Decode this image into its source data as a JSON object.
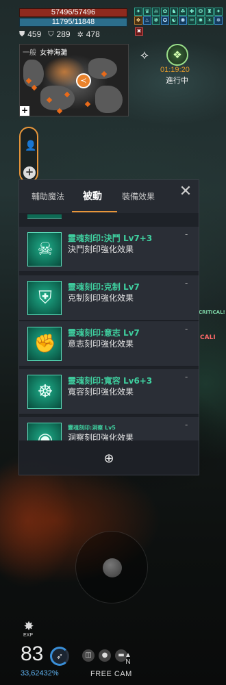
{
  "player": {
    "hp": "57496/57496",
    "mp": "11795/11848",
    "stats": [
      {
        "icon": "shield-icon",
        "glyph": "⛊",
        "value": "459"
      },
      {
        "icon": "defense-icon",
        "glyph": "⛉",
        "value": "289"
      },
      {
        "icon": "star-icon",
        "glyph": "✲",
        "value": "478"
      }
    ]
  },
  "buffs": {
    "row1": [
      "✦",
      "♛",
      "☠",
      "✿",
      "♞",
      "☘",
      "✚",
      "❂",
      "♜",
      "✦",
      "✧",
      "☗"
    ],
    "row2": [
      "❖",
      "♨",
      "❃",
      "✪",
      "☯",
      "✺",
      "♒",
      "✹",
      "☀",
      "✵",
      "❁",
      "✥"
    ],
    "debuff": "✖"
  },
  "minimap": {
    "mode": "一般",
    "zone": "女神海灘",
    "player_glyph": "≺",
    "zoom_label": "+"
  },
  "quest": {
    "timer": "01:19:20",
    "status": "進行中"
  },
  "panel": {
    "tabs": [
      {
        "label": "輔助魔法",
        "active": false
      },
      {
        "label": "被動",
        "active": true
      },
      {
        "label": "裝備效果",
        "active": false
      }
    ],
    "close_label": "✕",
    "items": [
      {
        "name": "靈魂刻印:決鬥 Lv7+3",
        "desc": "決鬥刻印強化效果",
        "glyph": "☠",
        "dash": "-"
      },
      {
        "name": "靈魂刻印:克制 Lv7",
        "desc": "克制刻印強化效果",
        "glyph": "⛨",
        "dash": "-"
      },
      {
        "name": "靈魂刻印:意志 Lv7",
        "desc": "意志刻印強化效果",
        "glyph": "✊",
        "dash": "-"
      },
      {
        "name": "靈魂刻印:寬容 Lv6+3",
        "desc": "寬容刻印強化效果",
        "glyph": "☸",
        "dash": "-"
      },
      {
        "name": "靈魂刻印:洞察 Lv5",
        "desc": "洞察刻印強化效果",
        "glyph": "◉",
        "dash": "-"
      }
    ],
    "zoom_label": "⊕"
  },
  "floating_text": [
    "CRITICAL!",
    "CALI"
  ],
  "hud_bottom": {
    "exp_label": "EXP",
    "level": "83",
    "exp_percent": "33,62432%",
    "free_cam_label": "FREE CAM",
    "compass_label": "N"
  }
}
